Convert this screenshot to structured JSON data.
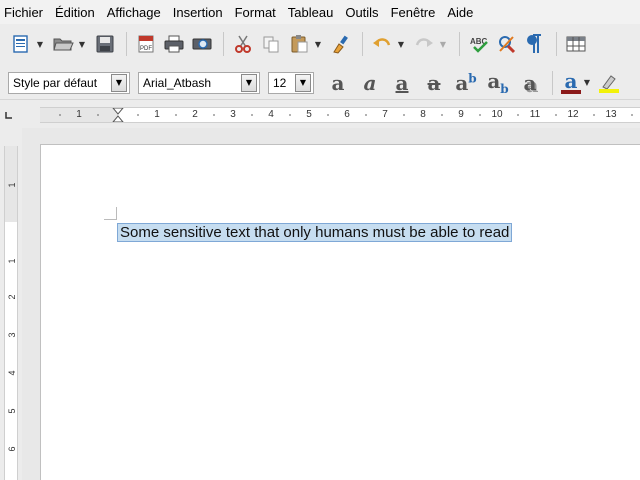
{
  "menu": {
    "items": [
      "Fichier",
      "Édition",
      "Affichage",
      "Insertion",
      "Format",
      "Tableau",
      "Outils",
      "Fenêtre",
      "Aide"
    ]
  },
  "toolbar": {
    "icons": [
      "new-document-icon",
      "open-folder-icon",
      "save-icon",
      "export-pdf-icon",
      "print-icon",
      "print-preview-icon",
      "cut-icon",
      "copy-icon",
      "paste-icon",
      "clone-formatting-icon",
      "undo-icon",
      "redo-icon",
      "spelling-icon",
      "autocorrect-icon",
      "formatting-marks-icon",
      "table-icon"
    ],
    "pdf_label": "PDF",
    "abc_label": "ABC"
  },
  "formatting": {
    "paragraph_style": "Style par défaut",
    "font_name": "Arial_Atbash",
    "font_size": "12",
    "buttons": [
      "bold",
      "italic",
      "underline",
      "strikethrough",
      "superscript",
      "subscript",
      "shadow",
      "font-color",
      "highlight"
    ],
    "glyph": "a",
    "superscript_glyph": "b",
    "font_color": "#8b1a1a",
    "highlight_color": "#f2f20a"
  },
  "ruler": {
    "h_labels": [
      "1",
      "1",
      "2",
      "3",
      "4",
      "5",
      "6",
      "7",
      "8",
      "9",
      "10",
      "11",
      "12",
      "13"
    ],
    "v_labels": [
      "1",
      "1",
      "2",
      "3",
      "4",
      "5",
      "6"
    ]
  },
  "document": {
    "text": "Some sensitive text that only humans must be able to read"
  },
  "colors": {
    "selection_bg": "#c6ddf0",
    "selection_border": "#7fa8d6"
  }
}
